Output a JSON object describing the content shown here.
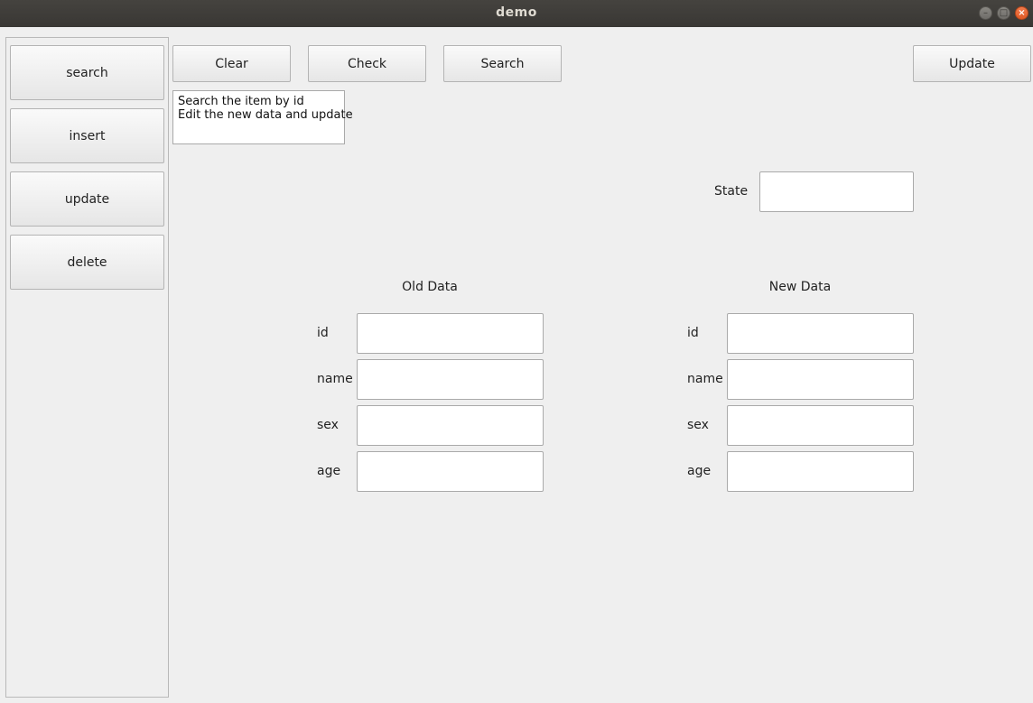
{
  "window": {
    "title": "demo"
  },
  "sidebar": {
    "items": [
      {
        "label": "search"
      },
      {
        "label": "insert"
      },
      {
        "label": "update"
      },
      {
        "label": "delete"
      }
    ]
  },
  "toolbar": {
    "clear_label": "Clear",
    "check_label": "Check",
    "search_label": "Search",
    "update_label": "Update"
  },
  "instructions": "Search the item by id\nEdit the new data and update",
  "state": {
    "label": "State",
    "value": ""
  },
  "old_data": {
    "title": "Old Data",
    "fields": [
      {
        "label": "id",
        "value": ""
      },
      {
        "label": "name",
        "value": ""
      },
      {
        "label": "sex",
        "value": ""
      },
      {
        "label": "age",
        "value": ""
      }
    ]
  },
  "new_data": {
    "title": "New Data",
    "fields": [
      {
        "label": "id",
        "value": ""
      },
      {
        "label": "name",
        "value": ""
      },
      {
        "label": "sex",
        "value": ""
      },
      {
        "label": "age",
        "value": ""
      }
    ]
  }
}
